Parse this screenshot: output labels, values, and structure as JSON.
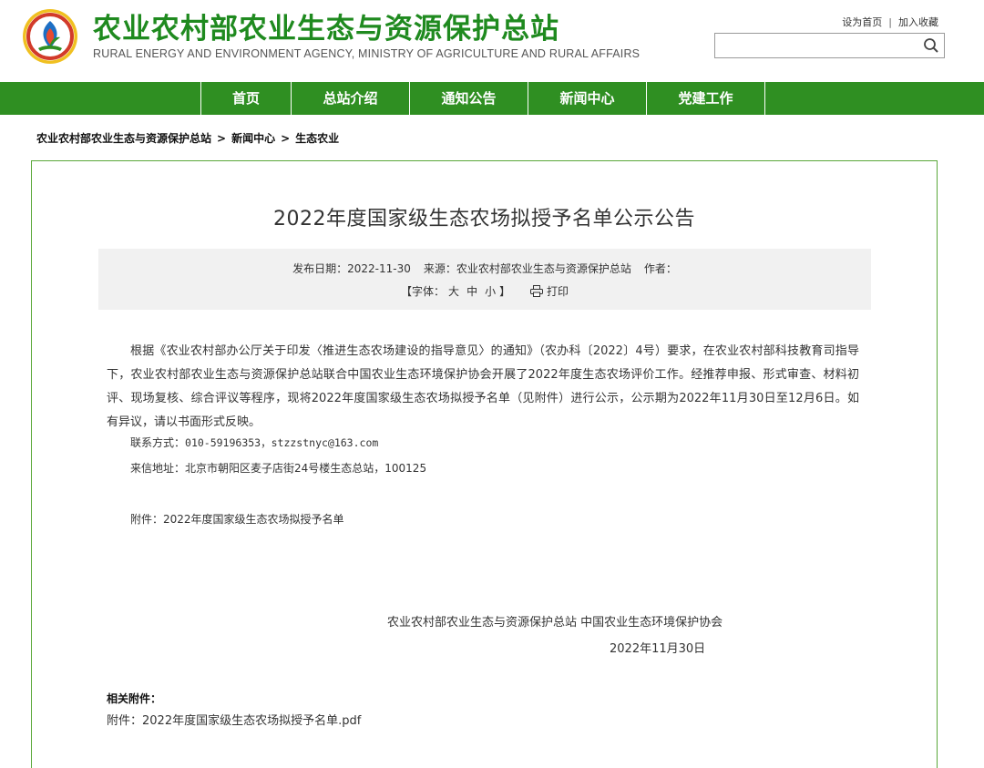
{
  "header": {
    "title": "农业农村部农业生态与资源保护总站",
    "subtitle": "RURAL ENERGY AND ENVIRONMENT AGENCY, MINISTRY OF AGRICULTURE AND RURAL AFFAIRS",
    "set_homepage": "设为首页",
    "separator": "|",
    "add_favorite": "加入收藏",
    "search_placeholder": "",
    "brand_color": "#1f8a1f"
  },
  "nav": {
    "color": "#2f8f22",
    "items": [
      {
        "label": "首页"
      },
      {
        "label": "总站介绍"
      },
      {
        "label": "通知公告"
      },
      {
        "label": "新闻中心"
      },
      {
        "label": "党建工作"
      }
    ]
  },
  "breadcrumb": {
    "items": [
      "农业农村部农业生态与资源保护总站",
      "新闻中心",
      "生态农业"
    ],
    "separator": ">"
  },
  "article": {
    "title": "2022年度国家级生态农场拟授予名单公示公告",
    "meta": {
      "date_label": "发布日期：",
      "date": "2022-11-30",
      "source_label": "来源：",
      "source": "农业农村部农业生态与资源保护总站",
      "author_label": "作者："
    },
    "font_size": {
      "open": "【字体：",
      "large": "大",
      "medium": "中",
      "small": "小",
      "close": "】"
    },
    "print_label": "打印",
    "body": "根据《农业农村部办公厅关于印发〈推进生态农场建设的指导意见〉的通知》（农办科〔2022〕4号）要求，在农业农村部科技教育司指导下，农业农村部农业生态与资源保护总站联合中国农业生态环境保护协会开展了2022年度生态农场评价工作。经推荐申报、形式审查、材料初评、现场复核、综合评议等程序，现将2022年度国家级生态农场拟授予名单（见附件）进行公示，公示期为2022年11月30日至12月6日。如有异议，请以书面形式反映。",
    "contact_label": "联系方式：",
    "contact_value": "010-59196353，stzzstnyc@163.com",
    "address": "来信地址：北京市朝阳区麦子店街24号楼生态总站，100125",
    "attachment_line": "附件：2022年度国家级生态农场拟授予名单",
    "signature": "农业农村部农业生态与资源保护总站 中国农业生态环境保护协会",
    "sign_date": "2022年11月30日"
  },
  "related": {
    "title": "相关附件：",
    "file_prefix": "附件：",
    "file_name": "2022年度国家级生态农场拟授予名单.pdf"
  }
}
